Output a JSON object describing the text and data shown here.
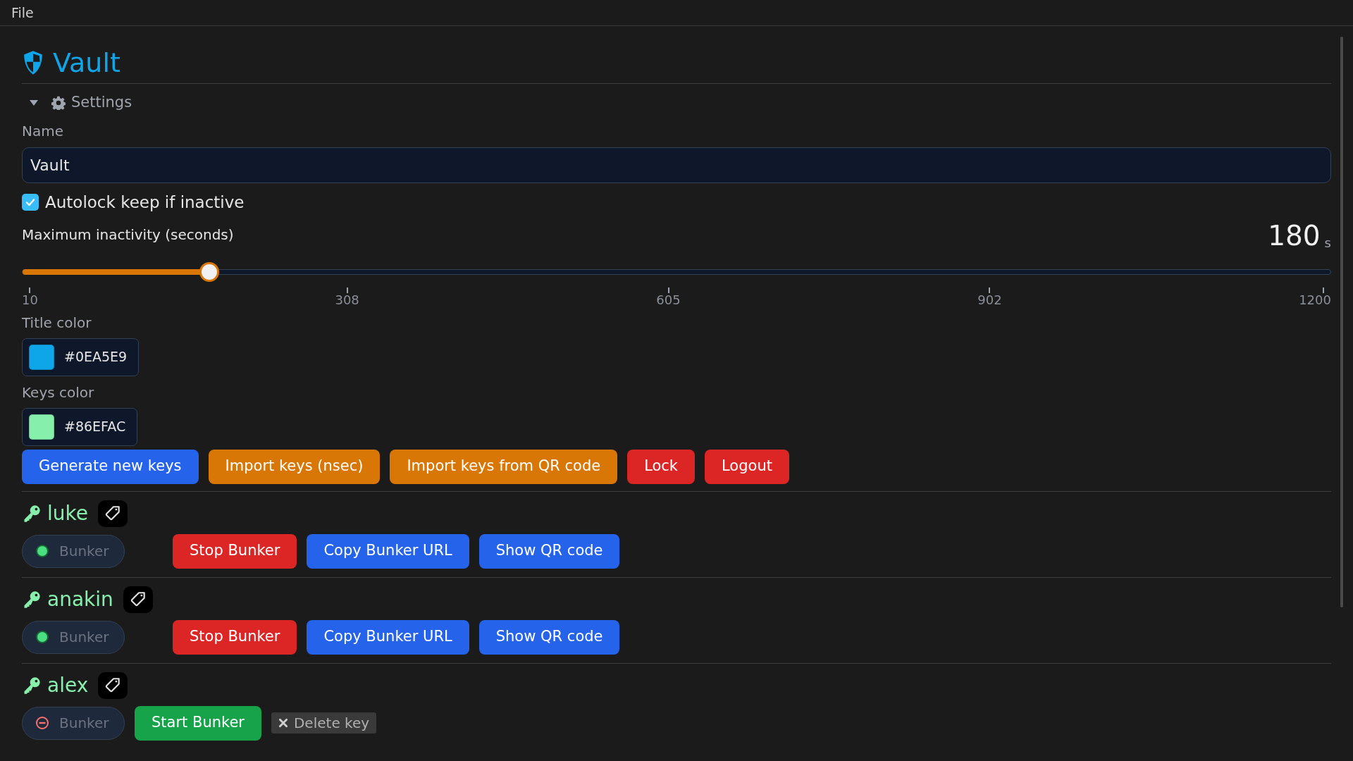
{
  "menu": [
    "File"
  ],
  "title": "Vault",
  "settings": {
    "label": "Settings",
    "expanded": true
  },
  "name_field": {
    "label": "Name",
    "value": "Vault"
  },
  "autolock": {
    "label": "Autolock keep if inactive",
    "checked": true
  },
  "inactivity": {
    "label": "Maximum inactivity (seconds)",
    "value": "180",
    "unit": "s",
    "level": 0.143,
    "ticks": [
      "10",
      "308",
      "605",
      "902",
      "1200"
    ]
  },
  "title_color": {
    "label": "Title color",
    "value": "#0EA5E9",
    "color": "#0ea5e9"
  },
  "keys_color": {
    "label": "Keys color",
    "value": "#86EFAC",
    "color": "#86efac"
  },
  "actions": [
    {
      "label": "Generate new keys",
      "kind": "primary"
    },
    {
      "label": "Import keys (nsec)",
      "kind": "warning"
    },
    {
      "label": "Import keys from QR code",
      "kind": "warning"
    },
    {
      "label": "Lock",
      "kind": "danger"
    },
    {
      "label": "Logout",
      "kind": "danger"
    }
  ],
  "keys": [
    {
      "name": "luke",
      "bunker": {
        "label": "Bunker",
        "running": true
      },
      "buttons": [
        {
          "label": "Stop Bunker",
          "kind": "danger"
        },
        {
          "label": "Copy Bunker URL",
          "kind": "primary"
        },
        {
          "label": "Show QR code",
          "kind": "primary"
        }
      ]
    },
    {
      "name": "anakin",
      "bunker": {
        "label": "Bunker",
        "running": true
      },
      "buttons": [
        {
          "label": "Stop Bunker",
          "kind": "danger"
        },
        {
          "label": "Copy Bunker URL",
          "kind": "primary"
        },
        {
          "label": "Show QR code",
          "kind": "primary"
        }
      ]
    },
    {
      "name": "alex",
      "bunker": {
        "label": "Bunker",
        "running": false
      },
      "buttons": [
        {
          "label": "Start Bunker",
          "kind": "success"
        },
        {
          "label": "Delete key",
          "kind": "plain"
        }
      ]
    }
  ]
}
